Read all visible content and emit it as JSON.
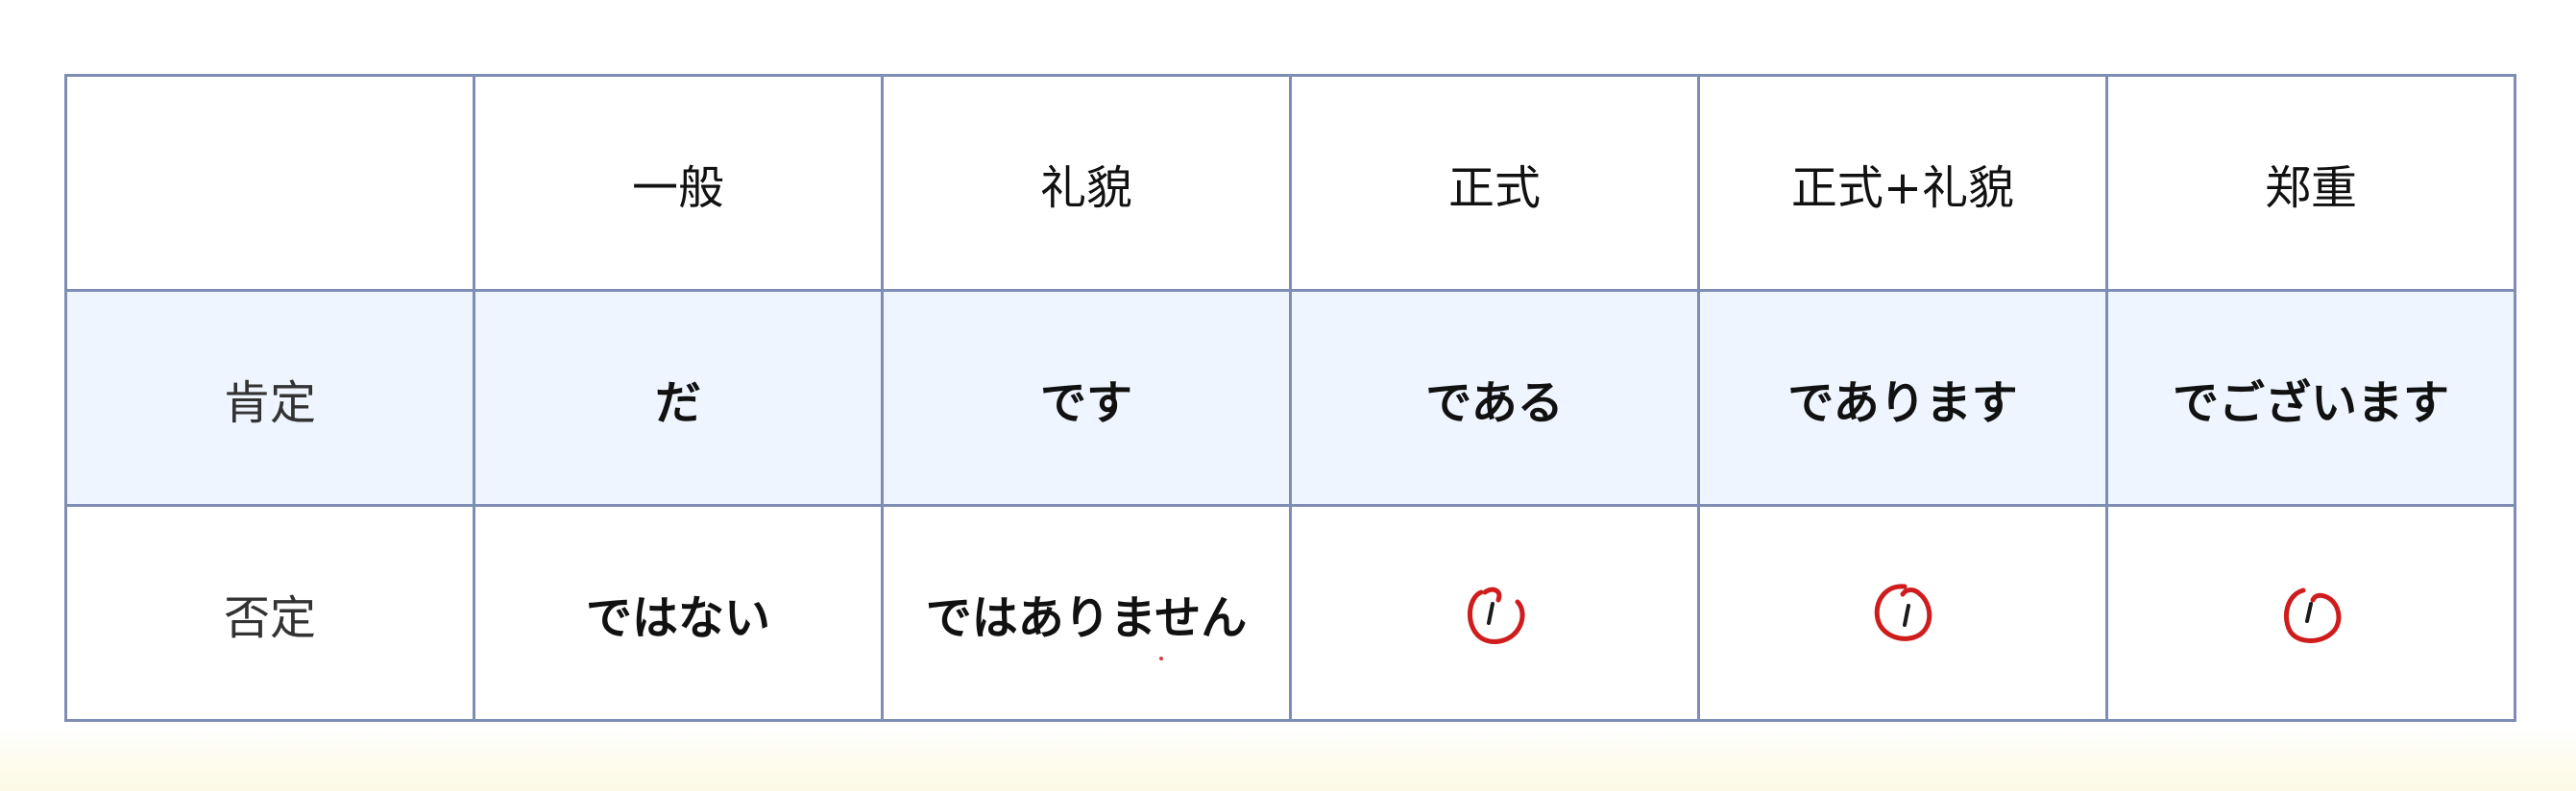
{
  "table": {
    "headers": [
      "",
      "一般",
      "礼貌",
      "正式",
      "正式+礼貌",
      "郑重"
    ],
    "rows": [
      {
        "label": "肯定",
        "cells": [
          "だ",
          "です",
          "である",
          "であります",
          "でございます"
        ]
      },
      {
        "label": "否定",
        "cells": [
          "ではない",
          "ではありません",
          "/",
          "/",
          "/"
        ]
      }
    ]
  },
  "colors": {
    "border": "#7e8db4",
    "positive_row_bg": "#eef5ff",
    "annotation_red": "#d01c1c"
  },
  "icons": {
    "annotation": "circled-slash-mark"
  }
}
